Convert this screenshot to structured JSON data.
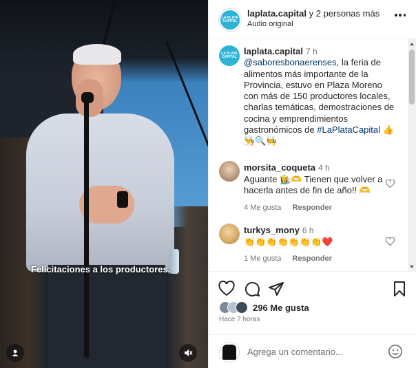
{
  "video": {
    "caption": "Felicitaciones a los productores,"
  },
  "header": {
    "username": "laplata.capital",
    "collab": " y 2 personas más",
    "audio": "Audio original",
    "avatar_text": "LA PLATA CAPITAL"
  },
  "post": {
    "username": "laplata.capital",
    "time": "7 h",
    "mention": "@saboresbonaerenses",
    "text": ", la feria de alimentos más importante de la Provincia, estuvo en Plaza Moreno con más de 150 productores locales, charlas temáticas, demostraciones de cocina y emprendimientos gastronómicos de ",
    "hashtag": "#LaPlataCapital",
    "trailing_emoji": "👍",
    "emoji_line": "👨‍🍳🔍🧑‍🍳"
  },
  "comments": [
    {
      "username": "morsita_coqueta",
      "time": "4 h",
      "text": "Aguante 👩‍🌾🫶 Tienen que volver a hacerla antes de fin de año!! 🫶",
      "likes": "4 Me gusta",
      "reply": "Responder"
    },
    {
      "username": "turkys_mony",
      "time": "6 h",
      "text": "👏👏👏👏👏👏👏❤️",
      "likes": "1 Me gusta",
      "reply": "Responder"
    }
  ],
  "actions": {
    "likes": "296 Me gusta",
    "ago": "Hace 7 horas"
  },
  "compose": {
    "placeholder": "Agrega un comentario..."
  },
  "colors": {
    "link": "#00376b",
    "muted": "#737373",
    "brand": "#2cb3d6",
    "heart": "#ed4956"
  }
}
